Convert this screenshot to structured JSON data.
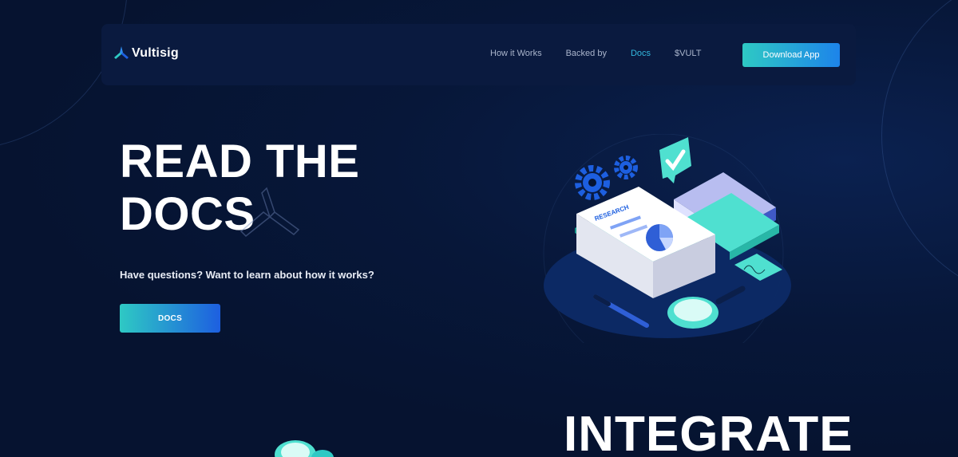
{
  "header": {
    "brand": "Vultisig",
    "nav": [
      {
        "label": "How it Works"
      },
      {
        "label": "Backed by"
      },
      {
        "label": "Docs",
        "active": true
      },
      {
        "label": "$VULT"
      }
    ],
    "cta_label": "Download App"
  },
  "hero": {
    "title_line1": "READ THE",
    "title_line2": "DOCS",
    "subtitle": "Have questions? Want to learn about how it works?",
    "button_label": "DOCS",
    "illustration": {
      "document_heading": "RESEARCH",
      "icons": [
        "gear-icon",
        "checkmark-badge-icon",
        "book-icon",
        "pen-icon",
        "magnifier-icon"
      ]
    }
  },
  "next_section": {
    "title": "INTEGRATE"
  },
  "colors": {
    "background": "#061330",
    "navbar": "#0a1a3f",
    "accent_teal": "#2ec9c4",
    "accent_blue": "#1d84ea",
    "active_link": "#33b7dd",
    "nav_text": "#aab5cc"
  }
}
